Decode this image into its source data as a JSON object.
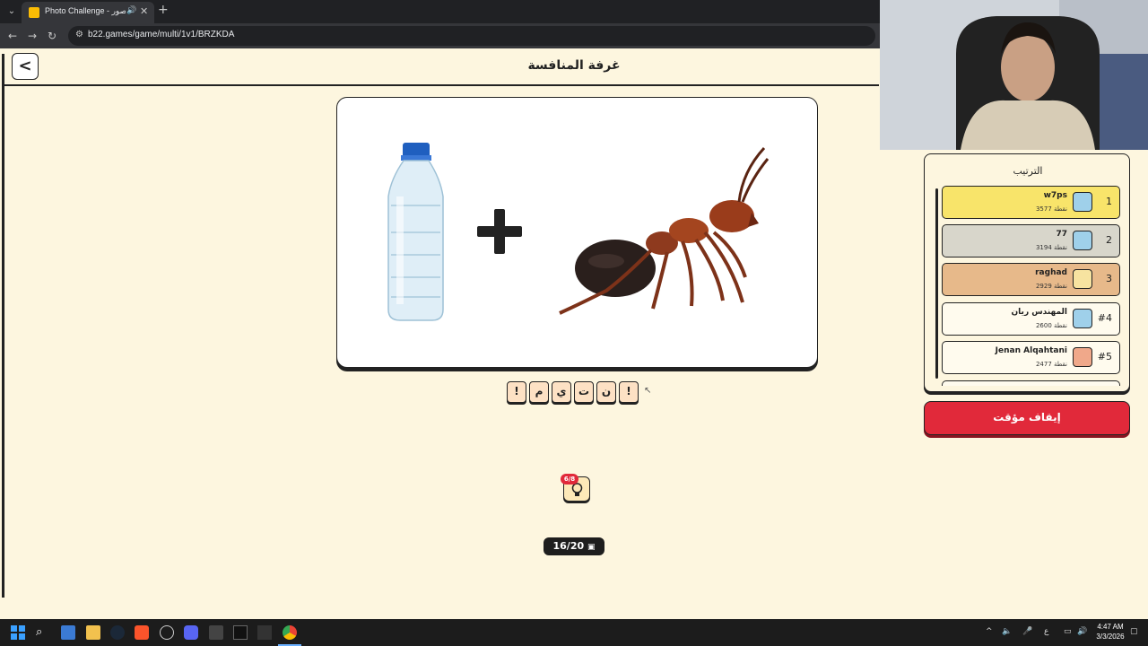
{
  "browser": {
    "tab_title": "Photo Challenge - ي الصور",
    "url": "b22.games/game/multi/1v1/BRZKDA",
    "new_tab_symbol": "+",
    "close_symbol": "✕"
  },
  "header": {
    "back_symbol": "<",
    "title": "غرفة المنافسة"
  },
  "puzzle": {
    "plus_symbol": "+",
    "answer_letters": [
      "!",
      "م",
      "ي",
      "ت",
      "ن",
      "!"
    ],
    "hint_count": "6/8",
    "progress": "16/20"
  },
  "leaderboard": {
    "title": "الترتيب",
    "rows": [
      {
        "rank": "1",
        "name": "w7ps",
        "score": "3577 نقطة",
        "color": "#f8e46a",
        "avatar_color": "#9fd0ea"
      },
      {
        "rank": "2",
        "name": "77",
        "score": "3194 نقطة",
        "color": "#d8d6cb",
        "avatar_color": "#9fd0ea"
      },
      {
        "rank": "3",
        "name": "raghad",
        "score": "2929 نقطة",
        "color": "#e7b98a",
        "avatar_color": "#f7e3a0"
      },
      {
        "rank": "#4",
        "name": "المهندس ريان",
        "score": "2600 نقطة",
        "color": "#fffbee",
        "avatar_color": "#9fd0ea"
      },
      {
        "rank": "#5",
        "name": "Jenan Alqahtani",
        "score": "2477 نقطة",
        "color": "#fffbee",
        "avatar_color": "#f0a88a"
      }
    ]
  },
  "pause_button": "إيقاف مؤقت",
  "taskbar": {
    "time": "4:47 AM",
    "date": "3/3/2026",
    "lang": "ع"
  },
  "colors": {
    "page_bg": "#fdf6df",
    "accent_red": "#e1293a"
  }
}
